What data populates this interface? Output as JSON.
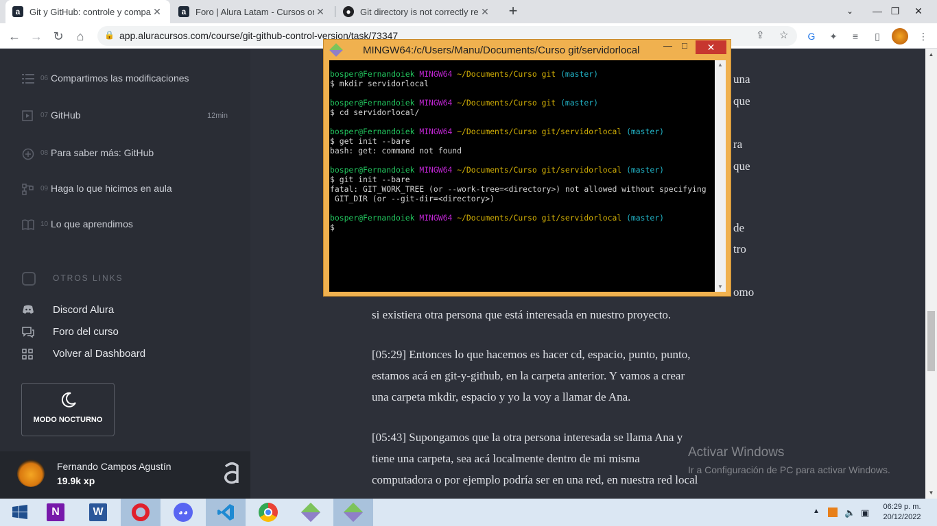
{
  "browser": {
    "tabs": [
      {
        "label": "Git y GitHub: controle y compart",
        "icon": "alura-icon",
        "active": true
      },
      {
        "label": "Foro | Alura Latam - Cursos onlin",
        "icon": "alura-icon",
        "active": false
      },
      {
        "label": "Git directory is not correctly reso",
        "icon": "github-icon",
        "active": false
      }
    ],
    "url": "app.aluracursos.com/course/git-github-control-version/task/73347"
  },
  "sidebar": {
    "lessons": [
      {
        "num": "06",
        "label": "Compartimos las modificaciones",
        "duration": "",
        "icon": "list-icon"
      },
      {
        "num": "07",
        "label": "GitHub",
        "duration": "12min",
        "icon": "play-icon"
      },
      {
        "num": "08",
        "label": "Para saber más: GitHub",
        "duration": "",
        "icon": "plus-circle-icon"
      },
      {
        "num": "09",
        "label": "Haga lo que hicimos en aula",
        "duration": "",
        "icon": "tasks-icon"
      },
      {
        "num": "10",
        "label": "Lo que aprendimos",
        "duration": "",
        "icon": "book-icon"
      }
    ],
    "otros_links_title": "OTROS LINKS",
    "links": [
      {
        "label": "Discord Alura",
        "icon": "discord-icon"
      },
      {
        "label": "Foro del curso",
        "icon": "forum-icon"
      },
      {
        "label": "Volver al Dashboard",
        "icon": "dashboard-icon"
      }
    ],
    "night_mode_label": "MODO NOCTURNO",
    "user": {
      "name": "Fernando Campos Agustín",
      "xp": "19.9k xp"
    }
  },
  "content": {
    "fragments": [
      "una",
      "que",
      "ra",
      "que",
      "de",
      "tro",
      "omo"
    ],
    "paragraphs": [
      {
        "lines": [
          "si existiera otra persona que está interesada en nuestro proyecto."
        ]
      },
      {
        "lines": [
          "[05:29] Entonces lo que hacemos es hacer cd, espacio, punto, punto,",
          "estamos acá en git-y-github, en la carpeta anterior. Y vamos a crear",
          "una carpeta mkdir, espacio y yo la voy a llamar de Ana."
        ]
      },
      {
        "lines": [
          "[05:43] Supongamos que la otra persona interesada se llama Ana y",
          "tiene una carpeta, sea acá localmente dentro de mi misma",
          "computadora o por ejemplo podría ser en una red, en nuestra red local"
        ]
      }
    ]
  },
  "terminal": {
    "title": "MINGW64:/c/Users/Manu/Documents/Curso git/servidorlocal",
    "lines": [
      [
        [
          "bosper@Fernandoiek ",
          "g"
        ],
        [
          "MINGW64 ",
          "m"
        ],
        [
          "~/Documents/Curso git ",
          "y"
        ],
        [
          "(master)",
          "c"
        ]
      ],
      [
        [
          "$ mkdir servidorlocal",
          "w"
        ]
      ],
      [],
      [
        [
          "bosper@Fernandoiek ",
          "g"
        ],
        [
          "MINGW64 ",
          "m"
        ],
        [
          "~/Documents/Curso git ",
          "y"
        ],
        [
          "(master)",
          "c"
        ]
      ],
      [
        [
          "$ cd servidorlocal/",
          "w"
        ]
      ],
      [],
      [
        [
          "bosper@Fernandoiek ",
          "g"
        ],
        [
          "MINGW64 ",
          "m"
        ],
        [
          "~/Documents/Curso git/servidorlocal ",
          "y"
        ],
        [
          "(master)",
          "c"
        ]
      ],
      [
        [
          "$ get init --bare",
          "w"
        ]
      ],
      [
        [
          "bash: get: command not found",
          "w"
        ]
      ],
      [],
      [
        [
          "bosper@Fernandoiek ",
          "g"
        ],
        [
          "MINGW64 ",
          "m"
        ],
        [
          "~/Documents/Curso git/servidorlocal ",
          "y"
        ],
        [
          "(master)",
          "c"
        ]
      ],
      [
        [
          "$ git init --bare",
          "w"
        ]
      ],
      [
        [
          "fatal: GIT_WORK_TREE (or --work-tree=<directory>) not allowed without specifying",
          "w"
        ]
      ],
      [
        [
          " GIT_DIR (or --git-dir=<directory>)",
          "w"
        ]
      ],
      [],
      [
        [
          "bosper@Fernandoiek ",
          "g"
        ],
        [
          "MINGW64 ",
          "m"
        ],
        [
          "~/Documents/Curso git/servidorlocal ",
          "y"
        ],
        [
          "(master)",
          "c"
        ]
      ],
      [
        [
          "$",
          "w"
        ]
      ]
    ]
  },
  "watermark": {
    "title": "Activar Windows",
    "subtitle": "Ir a Configuración de PC para activar Windows."
  },
  "taskbar": {
    "apps": [
      "windows-start",
      "onenote",
      "word",
      "opera",
      "discord",
      "vscode",
      "chrome",
      "git-gui",
      "git-bash"
    ],
    "time": "06:29 p. m.",
    "date": "20/12/2022"
  },
  "colors": {
    "sidebar_bg": "#2a2d35",
    "content_bg": "#2d3039",
    "terminal_frame": "#f0b14f",
    "taskbar_bg": "#dbe7f3"
  }
}
